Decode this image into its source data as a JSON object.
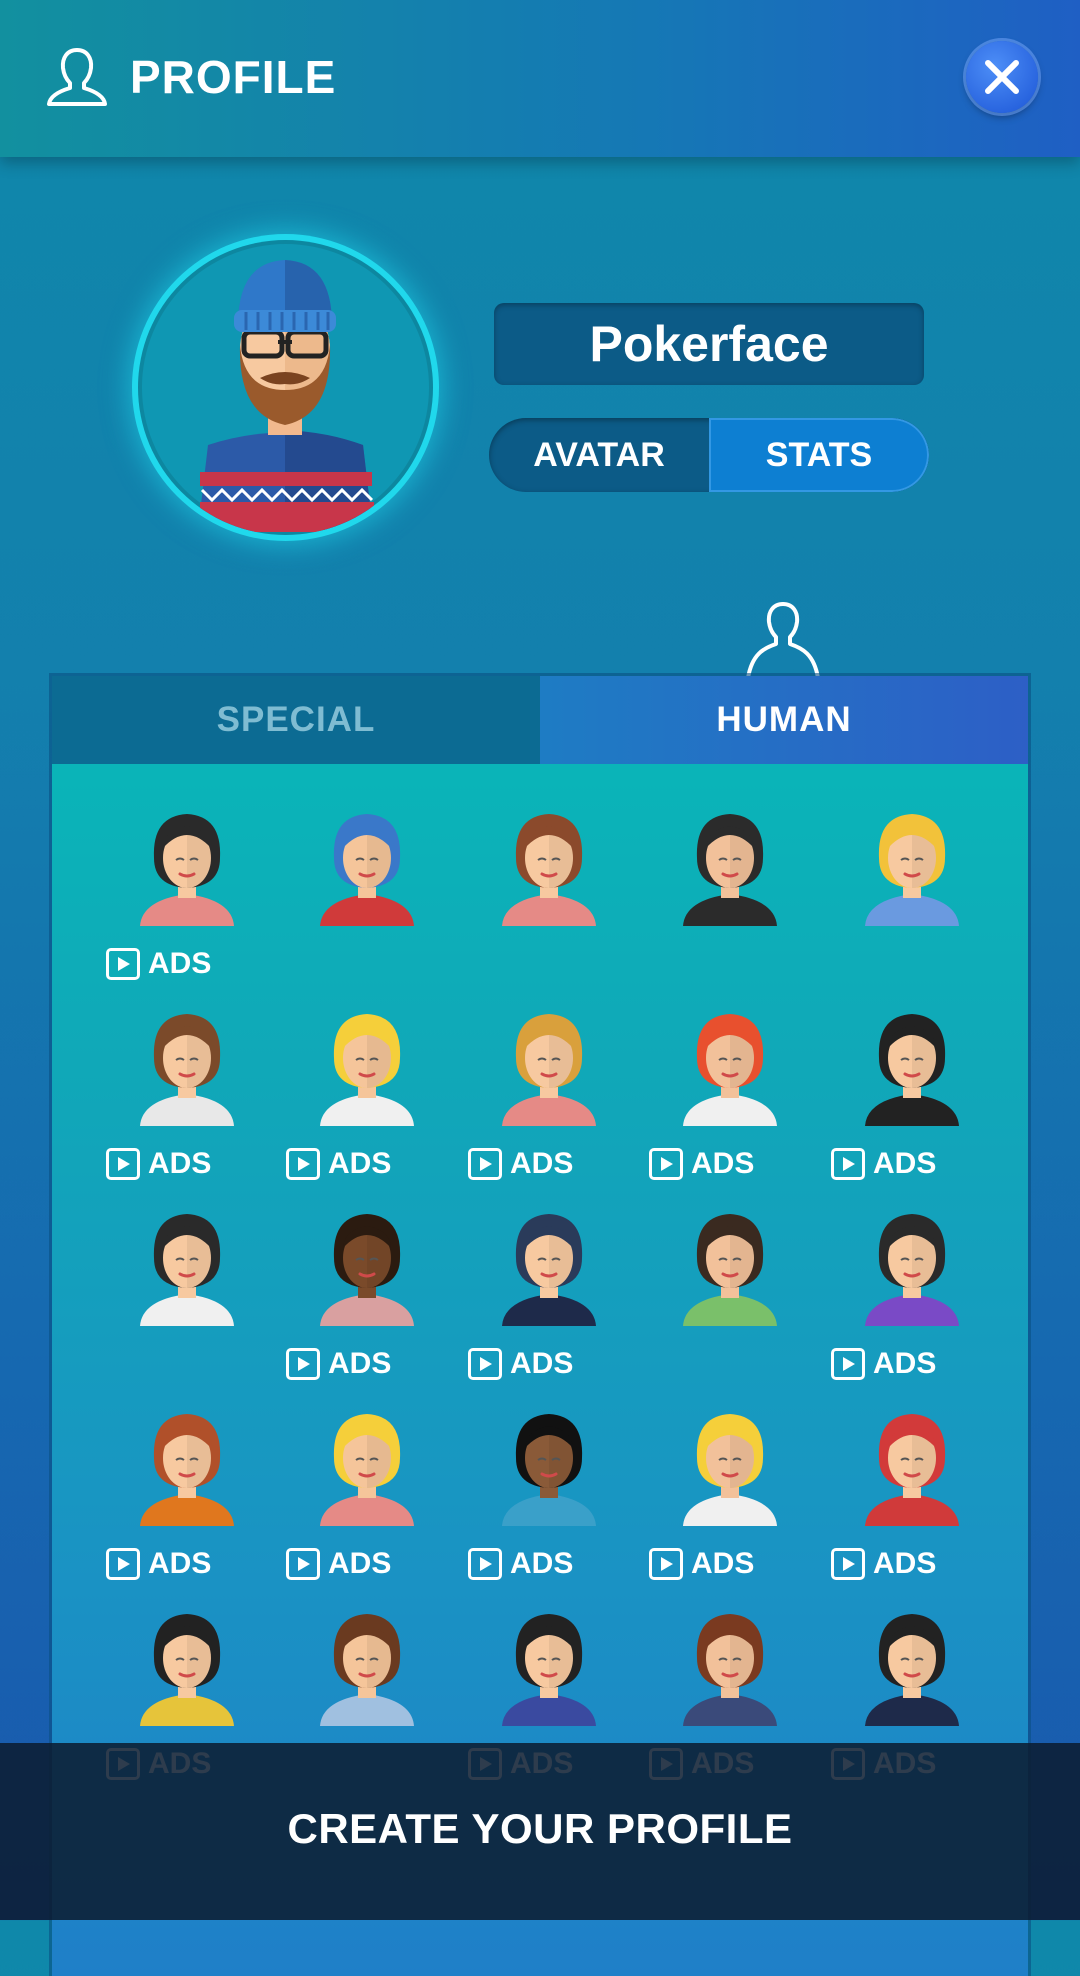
{
  "header": {
    "title": "PROFILE"
  },
  "profile": {
    "name": "Pokerface"
  },
  "toggle": {
    "avatar_label": "AVATAR",
    "stats_label": "STATS",
    "active": "STATS"
  },
  "tabs": {
    "special_label": "SPECIAL",
    "human_label": "HUMAN",
    "active": "HUMAN"
  },
  "ads_label": "ADS",
  "avatars": [
    {
      "name": "woman-black-hair",
      "ads": true
    },
    {
      "name": "man-beanie",
      "ads": false
    },
    {
      "name": "woman-bob",
      "ads": false
    },
    {
      "name": "man-sideburns-glasses",
      "ads": false
    },
    {
      "name": "woman-blonde-wavy",
      "ads": false
    },
    {
      "name": "man-hipster-glasses",
      "ads": true
    },
    {
      "name": "woman-blonde-bow",
      "ads": true
    },
    {
      "name": "man-long-hair-beard",
      "ads": true
    },
    {
      "name": "woman-red-curly",
      "ads": true
    },
    {
      "name": "man-top-hat",
      "ads": true
    },
    {
      "name": "woman-ponytail",
      "ads": false
    },
    {
      "name": "man-dark-skin",
      "ads": true
    },
    {
      "name": "woman-fedora",
      "ads": true
    },
    {
      "name": "man-bald-mustache",
      "ads": false
    },
    {
      "name": "woman-pigtails",
      "ads": true
    },
    {
      "name": "man-ginger-beard",
      "ads": true
    },
    {
      "name": "woman-blonde-curly",
      "ads": true
    },
    {
      "name": "man-afro",
      "ads": true
    },
    {
      "name": "woman-blonde-bob",
      "ads": true
    },
    {
      "name": "man-red-hat",
      "ads": true
    },
    {
      "name": "woman-black-bob",
      "ads": true
    },
    {
      "name": "man-mustache-glasses",
      "ads": false
    },
    {
      "name": "woman-bun",
      "ads": true
    },
    {
      "name": "man-suit",
      "ads": true
    },
    {
      "name": "woman-long-black-hair",
      "ads": true
    }
  ],
  "bottom": {
    "cta": "CREATE YOUR PROFILE"
  },
  "colors": {
    "accent": "#0d7fd2",
    "glow": "#20d8ec",
    "header": "#1578b5"
  }
}
